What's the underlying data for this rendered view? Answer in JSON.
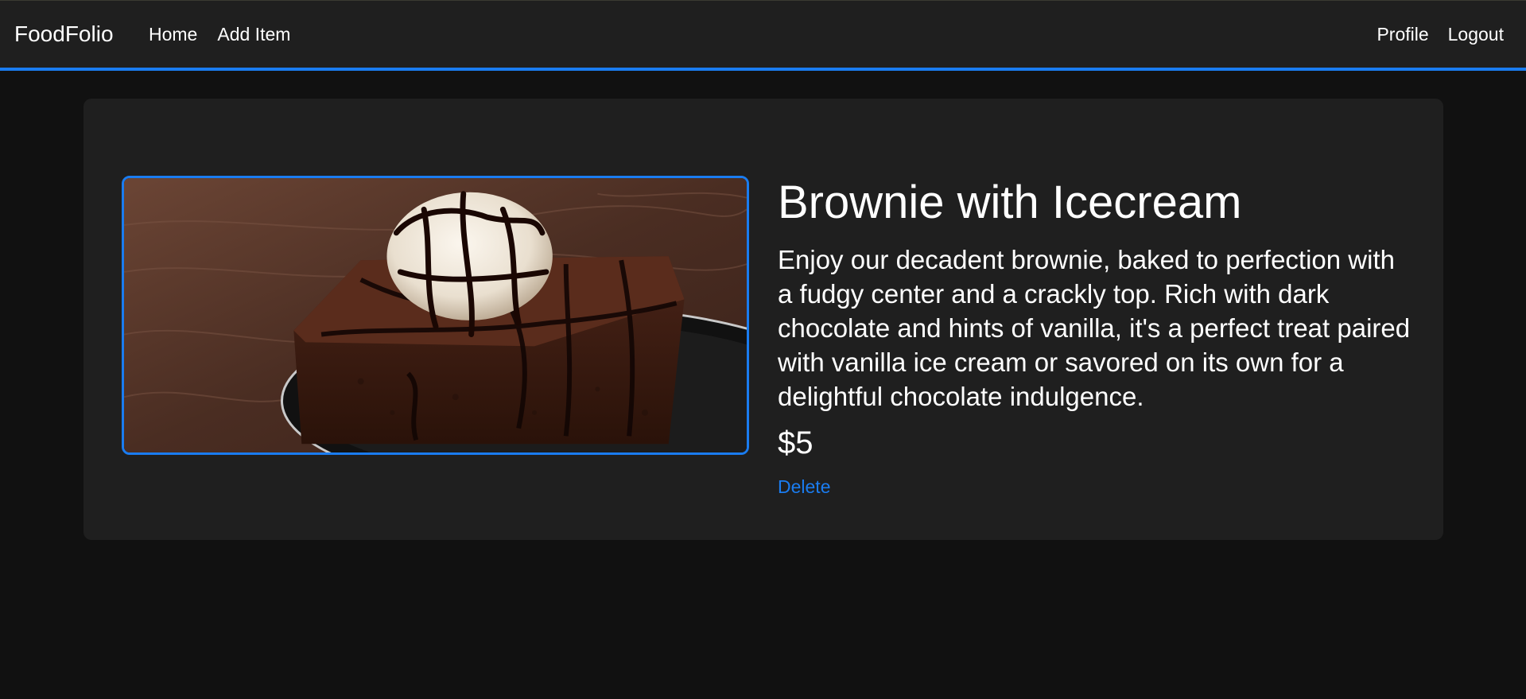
{
  "nav": {
    "brand": "FoodFolio",
    "links_left": [
      {
        "label": "Home"
      },
      {
        "label": "Add Item"
      }
    ],
    "links_right": [
      {
        "label": "Profile"
      },
      {
        "label": "Logout"
      }
    ]
  },
  "item": {
    "title": "Brownie with Icecream",
    "description": "Enjoy our decadent brownie, baked to perfection with a fudgy center and a crackly top. Rich with dark chocolate and hints of vanilla, it's a perfect treat paired with vanilla ice cream or savored on its own for a delightful chocolate indulgence.",
    "price": "$5",
    "delete_label": "Delete"
  },
  "colors": {
    "accent": "#1a7cf0",
    "page_background": "#111111",
    "surface": "#1f1f1f",
    "text": "#ffffff"
  }
}
